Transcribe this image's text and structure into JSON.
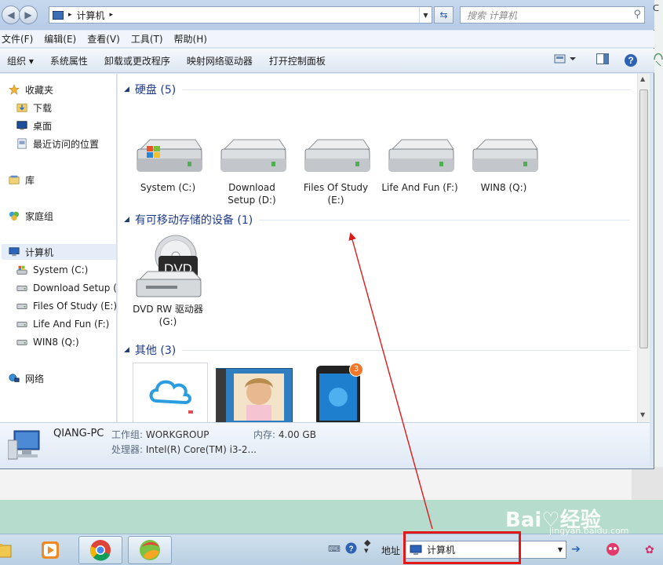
{
  "titlebar": {
    "breadcrumb_root_sep": "▸",
    "breadcrumb": "计算机",
    "breadcrumb_sep": "▸",
    "search_placeholder": "搜索 计算机"
  },
  "menubar": [
    "文件(F)",
    "编辑(E)",
    "查看(V)",
    "工具(T)",
    "帮助(H)"
  ],
  "toolbar": {
    "organize": "组织 ▾",
    "items": [
      "系统属性",
      "卸载或更改程序",
      "映射网络驱动器",
      "打开控制面板"
    ]
  },
  "nav": {
    "favorites": "收藏夹",
    "fav_items": [
      "下载",
      "桌面",
      "最近访问的位置"
    ],
    "libraries": "库",
    "homegroup": "家庭组",
    "computer": "计算机",
    "drives": [
      "System (C:)",
      "Download Setup (D:)",
      "Files Of Study (E:)",
      "Life And Fun (F:)",
      "WIN8 (Q:)"
    ],
    "network": "网络"
  },
  "content": {
    "groups": [
      {
        "title": "硬盘 (5)"
      },
      {
        "title": "有可移动存储的设备 (1)"
      },
      {
        "title": "其他 (3)"
      }
    ],
    "hard_drives": [
      {
        "l1": "System (C:)",
        "l2": ""
      },
      {
        "l1": "Download",
        "l2": "Setup (D:)"
      },
      {
        "l1": "Files Of Study",
        "l2": "(E:)"
      },
      {
        "l1": "Life And Fun (F:)",
        "l2": ""
      },
      {
        "l1": "WIN8 (Q:)",
        "l2": ""
      }
    ],
    "dvd": {
      "badge": "DVD",
      "l1": "DVD RW 驱动器",
      "l2": "(G:)"
    },
    "other_badge": "3"
  },
  "details": {
    "name": "QIANG-PC",
    "workgroup_key": "工作组:",
    "workgroup": "WORKGROUP",
    "memory_key": "内存:",
    "memory": "4.00 GB",
    "cpu_key": "处理器:",
    "cpu": "Intel(R) Core(TM) i3-2..."
  },
  "taskbar": {
    "address_label": "地址",
    "address_value": "计算机"
  },
  "watermark": {
    "main": "Bai♡经验",
    "sub": "jingyan.baidu.com"
  },
  "colors": {
    "annotation": "#e01818",
    "group_title": "#1e3a8a"
  }
}
